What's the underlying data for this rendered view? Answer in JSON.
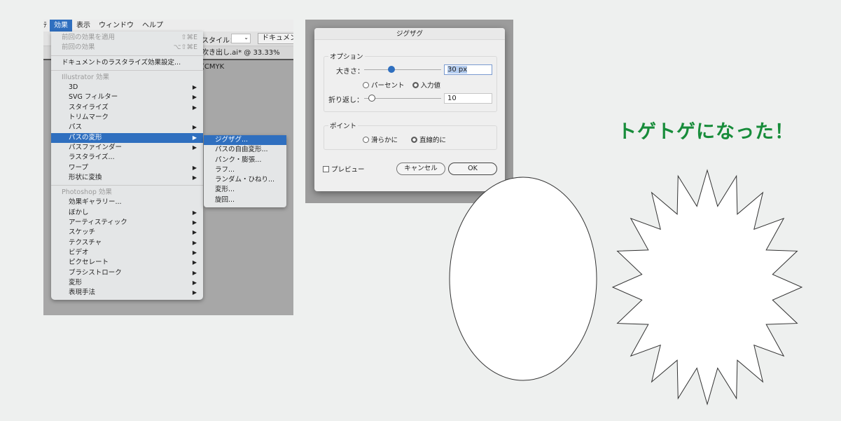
{
  "menubar": {
    "partial": "ﾃ",
    "items": [
      "効果",
      "表示",
      "ウィンドウ",
      "ヘルプ"
    ],
    "active": "効果"
  },
  "toolbar": {
    "style_label": "スタイル：",
    "doc_button": "ドキュメン"
  },
  "document_tab": {
    "title": "吹き出し.ai* @ 33.33% (CMYK"
  },
  "effect_menu": {
    "top": [
      {
        "label": "前回の効果を適用",
        "shortcut": "⇧⌘E"
      },
      {
        "label": "前回の効果",
        "shortcut": "⌥⇧⌘E"
      }
    ],
    "rasterize_settings": "ドキュメントのラスタライズ効果設定...",
    "illustrator_header": "Illustrator 効果",
    "illustrator_items": [
      {
        "label": "3D",
        "sub": true
      },
      {
        "label": "SVG フィルター",
        "sub": true
      },
      {
        "label": "スタイライズ",
        "sub": true
      },
      {
        "label": "トリムマーク",
        "sub": false
      },
      {
        "label": "パス",
        "sub": true
      },
      {
        "label": "パスの変形",
        "sub": true,
        "selected": true
      },
      {
        "label": "パスファインダー",
        "sub": true
      },
      {
        "label": "ラスタライズ...",
        "sub": false
      },
      {
        "label": "ワープ",
        "sub": true
      },
      {
        "label": "形状に変換",
        "sub": true
      }
    ],
    "photoshop_header": "Photoshop 効果",
    "photoshop_items": [
      {
        "label": "効果ギャラリー...",
        "sub": false
      },
      {
        "label": "ぼかし",
        "sub": true
      },
      {
        "label": "アーティスティック",
        "sub": true
      },
      {
        "label": "スケッチ",
        "sub": true
      },
      {
        "label": "テクスチャ",
        "sub": true
      },
      {
        "label": "ビデオ",
        "sub": true
      },
      {
        "label": "ピクセレート",
        "sub": true
      },
      {
        "label": "ブラシストローク",
        "sub": true
      },
      {
        "label": "変形",
        "sub": true
      },
      {
        "label": "表現手法",
        "sub": true
      }
    ]
  },
  "submenu": {
    "items": [
      "ジグザグ...",
      "パスの自由変形...",
      "パンク・膨張...",
      "ラフ...",
      "ランダム・ひねり...",
      "変形...",
      "旋回..."
    ],
    "selected": "ジグザグ..."
  },
  "dialog": {
    "title": "ジグザグ",
    "options_label": "オプション",
    "size_label": "大きさ：",
    "size_value": "30 px",
    "size_slider_fraction": 0.35,
    "percent_label": "パーセント",
    "absolute_label": "入力値",
    "unit_selected": "入力値",
    "ridges_label": "折り返し：",
    "ridges_value": "10",
    "ridges_slider_fraction": 0.1,
    "points_label": "ポイント",
    "smooth_label": "滑らかに",
    "corner_label": "直線的に",
    "points_selected": "直線的に",
    "preview_label": "プレビュー",
    "preview_checked": false,
    "cancel_label": "キャンセル",
    "ok_label": "OK"
  },
  "headline": {
    "text": "トゲトゲになった！",
    "color": "#178c3a"
  },
  "accent_color": "#2f6fbf"
}
